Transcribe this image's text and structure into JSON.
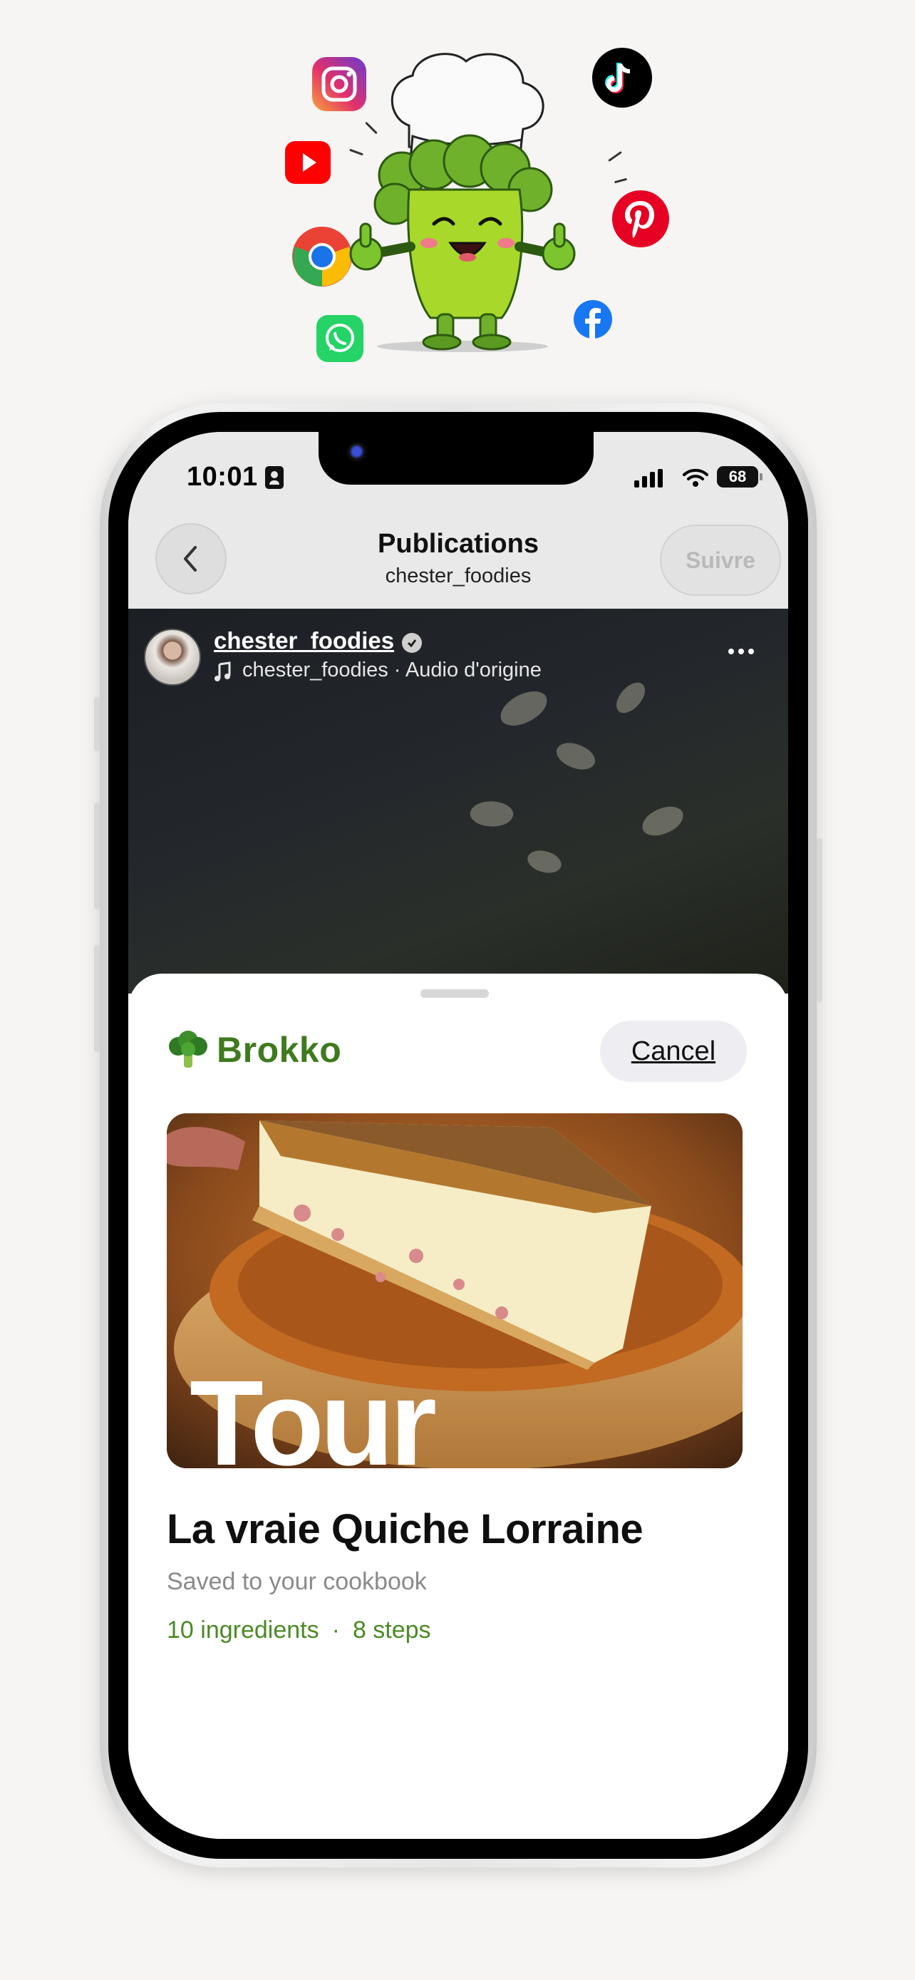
{
  "colors": {
    "brand_green": "#3f7a1f",
    "meta_green": "#4a8a25",
    "background": "#f6f5f3"
  },
  "hero": {
    "logos": [
      "instagram-icon",
      "youtube-icon",
      "chrome-icon",
      "whatsapp-icon",
      "tiktok-icon",
      "pinterest-icon",
      "facebook-icon"
    ],
    "mascot": "broccoli-chef-mascot"
  },
  "status_bar": {
    "time": "10:01",
    "battery": "68"
  },
  "navbar": {
    "title": "Publications",
    "subtitle": "chester_foodies",
    "follow_label": "Suivre"
  },
  "post": {
    "username": "chester_foodies",
    "audio": "chester_foodies · Audio d'origine"
  },
  "sheet": {
    "brand_name": "Brokko",
    "brand_icon": "broccoli-icon",
    "cancel_label": "Cancel",
    "image_overlay_text": "Tour",
    "recipe_title": "La vraie Quiche Lorraine",
    "saved_text": "Saved to your cookbook",
    "ingredients": "10 ingredients",
    "separator": "·",
    "steps": "8 steps"
  }
}
